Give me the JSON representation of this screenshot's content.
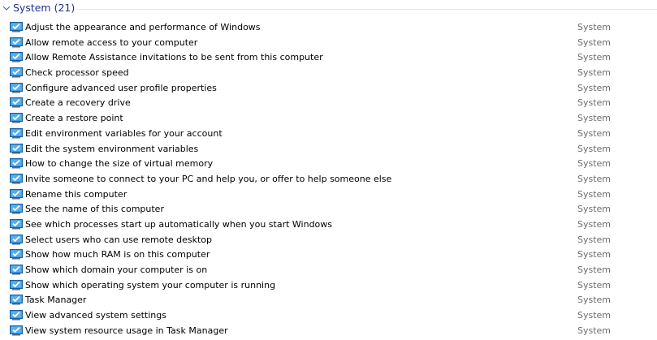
{
  "group": {
    "title": "System (21)",
    "icon": "chevron-down-icon"
  },
  "row_icon": "monitor-check-icon",
  "items": [
    {
      "label": "Adjust the appearance and performance of Windows",
      "category": "System"
    },
    {
      "label": "Allow remote access to your computer",
      "category": "System"
    },
    {
      "label": "Allow Remote Assistance invitations to be sent from this computer",
      "category": "System"
    },
    {
      "label": "Check processor speed",
      "category": "System"
    },
    {
      "label": "Configure advanced user profile properties",
      "category": "System"
    },
    {
      "label": "Create a recovery drive",
      "category": "System"
    },
    {
      "label": "Create a restore point",
      "category": "System"
    },
    {
      "label": "Edit environment variables for your account",
      "category": "System"
    },
    {
      "label": "Edit the system environment variables",
      "category": "System"
    },
    {
      "label": "How to change the size of virtual memory",
      "category": "System"
    },
    {
      "label": "Invite someone to connect to your PC and help you, or offer to help someone else",
      "category": "System"
    },
    {
      "label": "Rename this computer",
      "category": "System"
    },
    {
      "label": "See the name of this computer",
      "category": "System"
    },
    {
      "label": "See which processes start up automatically when you start Windows",
      "category": "System"
    },
    {
      "label": "Select users who can use remote desktop",
      "category": "System"
    },
    {
      "label": "Show how much RAM is on this computer",
      "category": "System"
    },
    {
      "label": "Show which domain your computer is on",
      "category": "System"
    },
    {
      "label": "Show which operating system your computer is running",
      "category": "System"
    },
    {
      "label": "Task Manager",
      "category": "System"
    },
    {
      "label": "View advanced system settings",
      "category": "System"
    },
    {
      "label": "View system resource usage in Task Manager",
      "category": "System"
    }
  ]
}
